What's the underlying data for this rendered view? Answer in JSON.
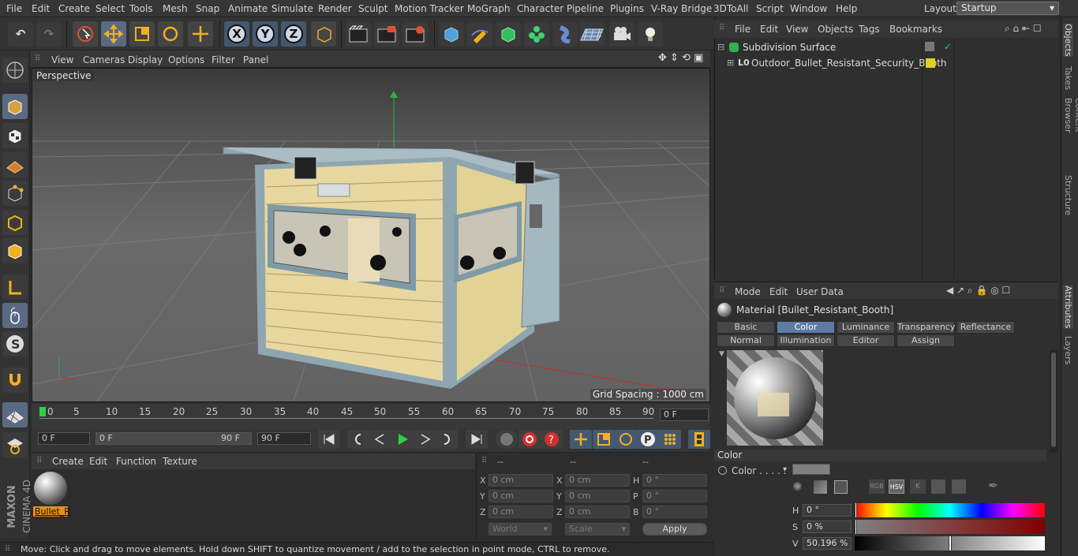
{
  "menubar": {
    "items": [
      "File",
      "Edit",
      "Create",
      "Select",
      "Tools",
      "Mesh",
      "Snap",
      "Animate",
      "Simulate",
      "Render",
      "Sculpt",
      "Motion Tracker",
      "MoGraph",
      "Character",
      "Pipeline",
      "Plugins",
      "V-Ray Bridge",
      "3DToAll",
      "Script",
      "Window",
      "Help"
    ],
    "layout_label": "Layout:",
    "layout_value": "Startup"
  },
  "toolbar": {
    "axis_x": "X",
    "axis_y": "Y",
    "axis_z": "Z"
  },
  "viewport": {
    "menu": [
      "View",
      "Cameras",
      "Display",
      "Options",
      "Filter",
      "Panel"
    ],
    "label": "Perspective",
    "grid_spacing": "Grid Spacing : 1000 cm"
  },
  "timeline": {
    "ticks": [
      "0",
      "5",
      "10",
      "15",
      "20",
      "25",
      "30",
      "35",
      "40",
      "45",
      "50",
      "55",
      "60",
      "65",
      "70",
      "75",
      "80",
      "85",
      "90"
    ],
    "current_frame": "0 F",
    "start_frame": "0 F",
    "range_start": "0 F",
    "range_end": "90 F",
    "end_frame": "90 F"
  },
  "material_manager": {
    "menu": [
      "Create",
      "Edit",
      "Function",
      "Texture"
    ],
    "material_name": "Bullet_R"
  },
  "coordinates": {
    "header": [
      "--",
      "--",
      "--"
    ],
    "rows": [
      {
        "a": "X",
        "av": "0 cm",
        "b": "X",
        "bv": "0 cm",
        "c": "H",
        "cv": "0 °"
      },
      {
        "a": "Y",
        "av": "0 cm",
        "b": "Y",
        "bv": "0 cm",
        "c": "P",
        "cv": "0 °"
      },
      {
        "a": "Z",
        "av": "0 cm",
        "b": "Z",
        "bv": "0 cm",
        "c": "B",
        "cv": "0 °"
      }
    ],
    "mode": "World",
    "scale": "Scale",
    "apply": "Apply"
  },
  "status": "Move: Click and drag to move elements. Hold down SHIFT to quantize movement / add to the selection in point mode, CTRL to remove.",
  "objects": {
    "menu": [
      "File",
      "Edit",
      "View",
      "Objects",
      "Tags",
      "Bookmarks"
    ],
    "items": [
      "Subdivision Surface",
      "Outdoor_Bullet_Resistant_Security_Booth"
    ]
  },
  "attributes": {
    "menu": [
      "Mode",
      "Edit",
      "User Data"
    ],
    "title": "Material [Bullet_Resistant_Booth]",
    "tabs_row1": [
      "Basic",
      "Color",
      "Luminance",
      "Transparency",
      "Reflectance"
    ],
    "tabs_row2": [
      "Normal",
      "Illumination",
      "Editor",
      "Assign"
    ],
    "active_tab": "Color",
    "section": "Color",
    "color_label": "Color . . . . .",
    "modes": [
      "RGB",
      "HSV",
      "K"
    ],
    "h_label": "H",
    "h_value": "0 °",
    "s_label": "S",
    "s_value": "0 %",
    "v_label": "V",
    "v_value": "50.196 %",
    "v_level": 0.502
  },
  "side_tabs": [
    "Objects",
    "Takes",
    "Content Browser",
    "Structure",
    "Attributes",
    "Layers"
  ],
  "brand": {
    "line1": "MAXON",
    "line2": "CINEMA 4D"
  },
  "colors": {
    "accent": "#5c7ca6",
    "booth_wall": "#e8d8a0",
    "booth_frame": "#8fa6b0"
  }
}
